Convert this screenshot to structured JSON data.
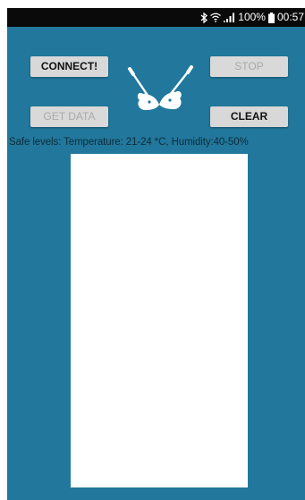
{
  "status_bar": {
    "battery_percent": "100%",
    "time": "00:57",
    "icons": [
      "bluetooth-icon",
      "wifi-icon",
      "signal-icon",
      "battery-icon"
    ]
  },
  "buttons": {
    "connect": {
      "label": "CONNECT!",
      "enabled": true
    },
    "stop": {
      "label": "STOP",
      "enabled": false
    },
    "get_data": {
      "label": "GET DATA",
      "enabled": false
    },
    "clear": {
      "label": "CLEAR",
      "enabled": true
    }
  },
  "logo": {
    "icon": "guitars-heart-logo"
  },
  "safe_levels_text": "Safe levels: Temperature: 21-24 *C, Humidity:40-50%",
  "colors": {
    "app_background": "#21789c",
    "status_bar": "#0a0a0a",
    "button_background": "#d8d8d8",
    "disabled_text": "#a9a9a9"
  }
}
